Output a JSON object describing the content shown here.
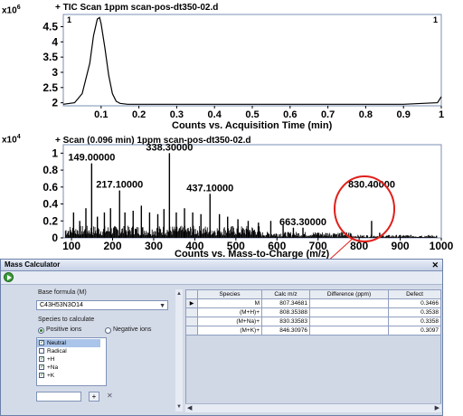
{
  "tic_panel": {
    "title": "+ TIC Scan 1ppm scan-pos-dt350-02.d",
    "y_exponent": "x10",
    "y_exponent_power": "6",
    "xlabel": "Counts vs. Acquisition Time (min)",
    "y_ticks": [
      "4.5",
      "4",
      "3.5",
      "3",
      "2.5",
      "2"
    ],
    "x_ticks": [
      "0.1",
      "0.2",
      "0.3",
      "0.4",
      "0.5",
      "0.6",
      "0.7",
      "0.8",
      "0.9",
      "1"
    ],
    "peak_marker_left": "1",
    "peak_marker_right": "1"
  },
  "scan_panel": {
    "title": "+ Scan (0.096 min) 1ppm scan-pos-dt350-02.d",
    "y_exponent": "x10",
    "y_exponent_power": "4",
    "xlabel": "Counts vs. Mass-to-Charge (m/z)",
    "y_ticks": [
      "1",
      "0.8",
      "0.6",
      "0.4",
      "0.2",
      "0"
    ],
    "x_ticks": [
      "100",
      "200",
      "300",
      "400",
      "500",
      "600",
      "700",
      "800",
      "900",
      "1000"
    ],
    "peak_labels": [
      "149.00000",
      "217.10000",
      "338.30000",
      "437.10000",
      "663.30000",
      "830.40000"
    ]
  },
  "chart_data": [
    {
      "type": "line",
      "title": "+ TIC Scan 1ppm scan-pos-dt350-02.d",
      "xlabel": "Counts vs. Acquisition Time (min)",
      "ylabel": "",
      "y_scale": "x10^6",
      "xlim": [
        0,
        1
      ],
      "ylim": [
        1.9,
        4.9
      ],
      "x": [
        0.0,
        0.03,
        0.05,
        0.07,
        0.08,
        0.09,
        0.096,
        0.1,
        0.11,
        0.12,
        0.13,
        0.14,
        0.15,
        0.17,
        0.2,
        0.25,
        0.3,
        0.4,
        0.5,
        0.6,
        0.7,
        0.8,
        0.9,
        0.99,
        1.0
      ],
      "y": [
        1.95,
        2.0,
        2.3,
        3.3,
        4.2,
        4.75,
        4.8,
        4.6,
        3.8,
        2.9,
        2.3,
        2.05,
        1.98,
        1.95,
        1.95,
        1.95,
        1.95,
        1.95,
        1.95,
        1.95,
        1.95,
        1.95,
        1.95,
        2.0,
        2.2
      ]
    },
    {
      "type": "bar",
      "title": "+ Scan (0.096 min) 1ppm scan-pos-dt350-02.d",
      "xlabel": "Counts vs. Mass-to-Charge (m/z)",
      "ylabel": "",
      "y_scale": "x10^4",
      "xlim": [
        80,
        1000
      ],
      "ylim": [
        0,
        1.1
      ],
      "x": [
        105,
        120,
        135,
        149,
        163,
        180,
        195,
        217,
        230,
        250,
        270,
        290,
        310,
        325,
        338.3,
        355,
        375,
        395,
        415,
        437.1,
        460,
        480,
        505,
        530,
        555,
        585,
        615,
        640,
        663.3,
        700,
        740,
        780,
        830.4,
        850,
        900,
        950
      ],
      "values": [
        0.3,
        0.2,
        0.35,
        0.88,
        0.25,
        0.3,
        0.35,
        0.56,
        0.3,
        0.32,
        0.38,
        0.3,
        0.28,
        0.34,
        1.0,
        0.3,
        0.35,
        0.3,
        0.28,
        0.52,
        0.28,
        0.25,
        0.22,
        0.2,
        0.18,
        0.2,
        0.15,
        0.12,
        0.12,
        0.06,
        0.05,
        0.05,
        0.2,
        0.06,
        0.03,
        0.02
      ]
    }
  ],
  "mass_calculator": {
    "title": "Mass Calculator",
    "close": "✕",
    "base_formula_label": "Base formula (M)",
    "base_formula_value": "C43H53N3O14",
    "species_label": "Species to calculate",
    "positive_label": "Positive ions",
    "negative_label": "Negative ions",
    "species_items": [
      "Neutral",
      "Radical",
      "+H",
      "+Na",
      "+K"
    ],
    "add_button": "+",
    "remove_button": "✕",
    "table": {
      "headers": [
        "",
        "Species",
        "Calc m/z",
        "Difference (ppm)",
        "Defect"
      ],
      "rows": [
        {
          "marker": "▶",
          "species": "M",
          "calc": "807.34681",
          "diff": "",
          "defect": "0.3466"
        },
        {
          "marker": "",
          "species": "(M+H)+",
          "calc": "808.35388",
          "diff": "",
          "defect": "0.3538"
        },
        {
          "marker": "",
          "species": "(M+Na)+",
          "calc": "830.33583",
          "diff": "",
          "defect": "0.3358"
        },
        {
          "marker": "",
          "species": "(M+K)+",
          "calc": "846.30976",
          "diff": "",
          "defect": "0.3097"
        }
      ]
    }
  }
}
